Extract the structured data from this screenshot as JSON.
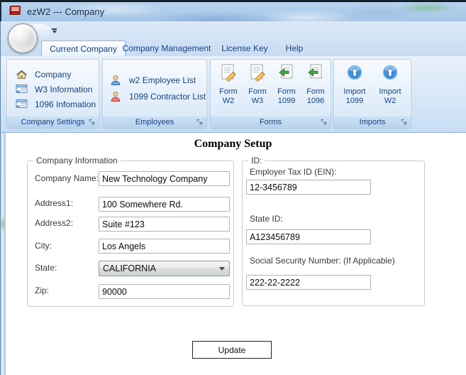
{
  "window": {
    "title": "ezW2 --- Company"
  },
  "tabs": {
    "current_company": "Current Company",
    "company_management": "Company Management",
    "license_key": "License Key",
    "help": "Help"
  },
  "ribbon": {
    "company_settings": {
      "caption": "Company Settings",
      "items": [
        {
          "label": "Company",
          "icon": "home-icon"
        },
        {
          "label": "W3 Information",
          "icon": "form-card-icon"
        },
        {
          "label": "1096 Infomation",
          "icon": "form-card-icon"
        }
      ]
    },
    "employees": {
      "caption": "Employees",
      "items": [
        {
          "label": "w2 Employee List",
          "icon": "person-blue-icon"
        },
        {
          "label": "1099 Contractor List",
          "icon": "person-red-icon"
        }
      ]
    },
    "forms": {
      "caption": "Forms",
      "items": [
        {
          "line1": "Form",
          "line2": "W2",
          "icon": "document-edit-icon"
        },
        {
          "line1": "Form",
          "line2": "W3",
          "icon": "document-edit-icon"
        },
        {
          "line1": "Form",
          "line2": "1099",
          "icon": "document-arrow-icon"
        },
        {
          "line1": "Form",
          "line2": "1096",
          "icon": "document-arrow-icon"
        }
      ]
    },
    "imports": {
      "caption": "Imports",
      "items": [
        {
          "line1": "Import",
          "line2": "1099",
          "icon": "import-up-icon"
        },
        {
          "line1": "Import",
          "line2": "W2",
          "icon": "import-up-icon"
        }
      ]
    }
  },
  "main": {
    "heading": "Company Setup",
    "company_info": {
      "legend": "Company Information",
      "fields": [
        {
          "label": "Company Name:",
          "value": "New Technology Company"
        },
        {
          "label": "Address1:",
          "value": "100 Somewhere Rd."
        },
        {
          "label": "Address2:",
          "value": "Suite #123"
        },
        {
          "label": "City:",
          "value": "Los Angels"
        },
        {
          "label": "State:",
          "value": "CALIFORNIA"
        },
        {
          "label": "Zip:",
          "value": "90000"
        }
      ]
    },
    "id_info": {
      "legend": "ID:",
      "fields": [
        {
          "label": "Employer Tax ID (EIN):",
          "value": "12-3456789"
        },
        {
          "label": "State ID:",
          "value": "A123456789"
        },
        {
          "label": "Social Security Number: (If Applicable)",
          "value": "222-22-2222"
        }
      ]
    },
    "update_button": "Update"
  },
  "colors": {
    "accent_text": "#15428b",
    "titlebar_glass": "#aecdeb",
    "ribbon_bg": "#d6e7f8",
    "group_caption_bg": "#b7d1ec",
    "app_logo_red": "#d93025"
  }
}
